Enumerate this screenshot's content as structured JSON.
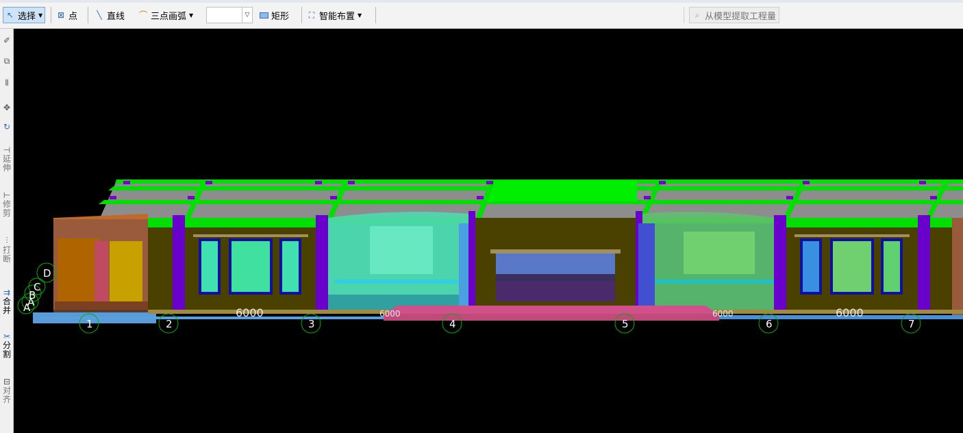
{
  "toolbar": {
    "select_label": "选择",
    "point_label": "点",
    "line_label": "直线",
    "arc_label": "三点画弧",
    "arc_value": "",
    "rect_label": "矩形",
    "smart_layout_label": "智能布置",
    "extract_label": "从模型提取工程量"
  },
  "sidebar": {
    "extend_label": "延伸",
    "trim_label": "修剪",
    "break_label": "打断",
    "merge_label": "合并",
    "split_label": "分割",
    "align_label": "对齐"
  },
  "model": {
    "axis_numbers": [
      "1",
      "2",
      "3",
      "4",
      "5",
      "6",
      "7"
    ],
    "axis_letters": [
      "D",
      "C",
      "B",
      "A",
      "A"
    ],
    "dimension_labels": [
      "6000",
      "6000",
      "6000",
      "6000"
    ],
    "colors": {
      "roof_green": "#00e000",
      "roof_gray": "#8d8d8d",
      "column_purple": "#6a00cc",
      "wall_olive": "#4a4100",
      "glass_teal": "#40e0b0",
      "pink_step": "#d0508a"
    }
  }
}
